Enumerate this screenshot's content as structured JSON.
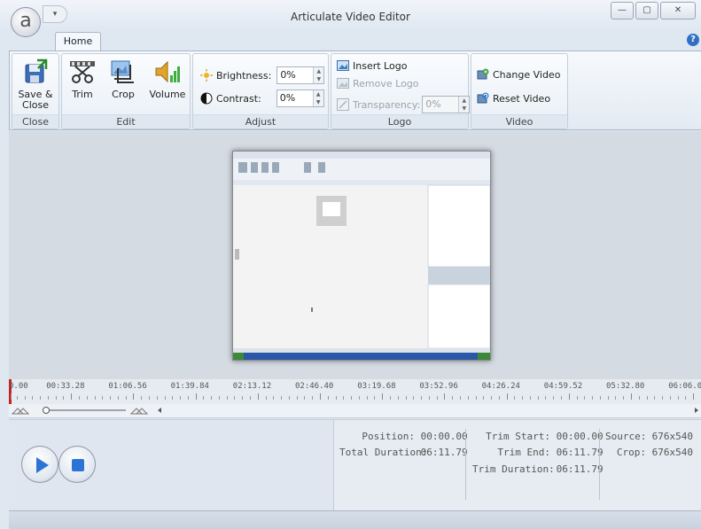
{
  "window": {
    "title": "Articulate Video Editor",
    "logo_letter": "a",
    "qat_glyph": "▾",
    "minimize_glyph": "—",
    "maximize_glyph": "▢",
    "close_glyph": "✕"
  },
  "ribbon": {
    "tab": "Home",
    "help_glyph": "?",
    "groups": {
      "close": {
        "label": "Close",
        "save_close_line1": "Save &",
        "save_close_line2": "Close"
      },
      "edit": {
        "label": "Edit",
        "trim": "Trim",
        "crop": "Crop",
        "volume": "Volume"
      },
      "adjust": {
        "label": "Adjust",
        "brightness_label": "Brightness:",
        "brightness_value": "0%",
        "contrast_label": "Contrast:",
        "contrast_value": "0%"
      },
      "logo": {
        "label": "Logo",
        "insert_logo": "Insert Logo",
        "remove_logo": "Remove Logo",
        "transparency_label": "Transparency:",
        "transparency_value": "0%"
      },
      "video": {
        "label": "Video",
        "change_video": "Change Video",
        "reset_video": "Reset Video"
      }
    }
  },
  "timeline": {
    "ticks": [
      "0.00",
      "00:33.28",
      "01:06.56",
      "01:39.84",
      "02:13.12",
      "02:46.40",
      "03:19.68",
      "03:52.96",
      "04:26.24",
      "04:59.52",
      "05:32.80",
      "06:06.0"
    ]
  },
  "info": {
    "position_label": "Position:",
    "position_value": "00:00.00",
    "total_duration_label": "Total Duration:",
    "total_duration_value": "06:11.79",
    "trim_start_label": "Trim Start:",
    "trim_start_value": "00:00.00",
    "trim_end_label": "Trim End:",
    "trim_end_value": "06:11.79",
    "trim_duration_label": "Trim Duration:",
    "trim_duration_value": "06:11.79",
    "source_label": "Source:",
    "source_value": "676x540",
    "crop_label": "Crop:",
    "crop_value": "676x540"
  },
  "colors": {
    "playhead": "#cc1f1f",
    "play_triangle": "#2b73d4",
    "stop_square": "#2b73d4"
  }
}
